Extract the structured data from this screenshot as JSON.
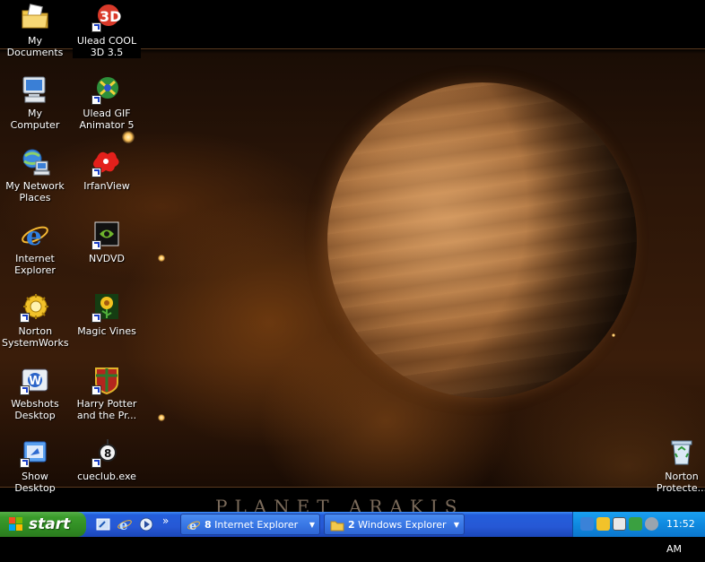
{
  "desktop": {
    "wallpaper_title": "PLANET ARAKIS",
    "icons": [
      {
        "label": "My Documents"
      },
      {
        "label": "Ulead COOL 3D 3.5"
      },
      {
        "label": "My Computer"
      },
      {
        "label": "Ulead GIF Animator 5"
      },
      {
        "label": "My Network Places"
      },
      {
        "label": "IrfanView"
      },
      {
        "label": "Internet Explorer"
      },
      {
        "label": "NVDVD"
      },
      {
        "label": "Norton SystemWorks"
      },
      {
        "label": "Magic Vines"
      },
      {
        "label": "Webshots Desktop"
      },
      {
        "label": "Harry Potter and the Pr..."
      },
      {
        "label": "Show Desktop"
      },
      {
        "label": "cueclub.exe"
      },
      {
        "label": "Norton Protecte..."
      }
    ]
  },
  "taskbar": {
    "start_label": "start",
    "chevron": "»",
    "buttons": [
      {
        "count": "8",
        "label": "Internet Explorer",
        "icon": "ie-icon"
      },
      {
        "count": "2",
        "label": "Windows Explorer",
        "icon": "folder-icon"
      }
    ],
    "clock": "11:52 AM"
  },
  "colors": {
    "taskbar_blue": "#245edb",
    "start_green": "#3b9c2c",
    "tray_blue": "#0f8ae0"
  }
}
